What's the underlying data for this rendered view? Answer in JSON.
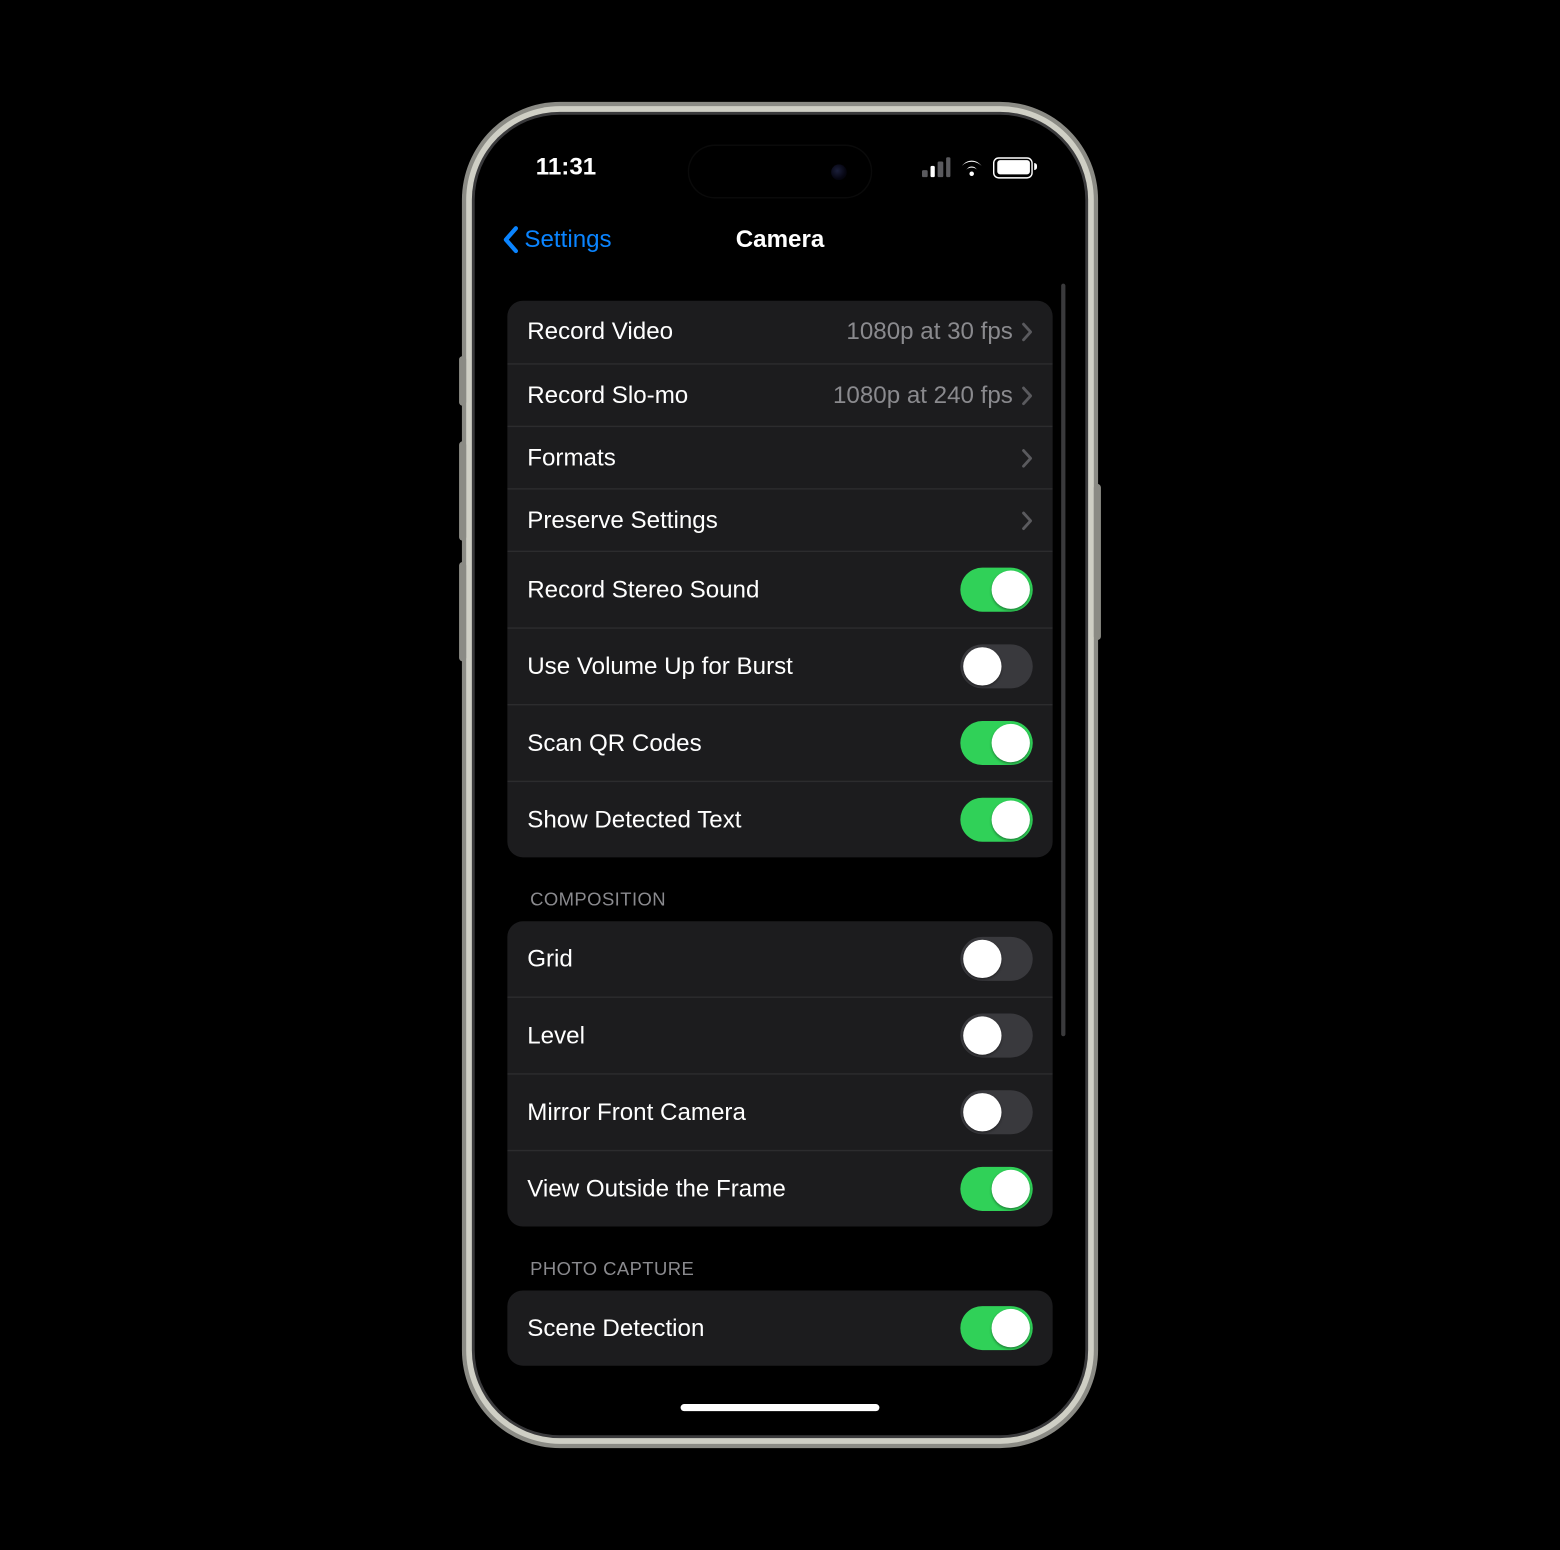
{
  "status": {
    "time": "11:31"
  },
  "nav": {
    "back_label": "Settings",
    "title": "Camera"
  },
  "group1": {
    "record_video": {
      "label": "Record Video",
      "value": "1080p at 30 fps"
    },
    "record_slomo": {
      "label": "Record Slo-mo",
      "value": "1080p at 240 fps"
    },
    "formats": {
      "label": "Formats"
    },
    "preserve": {
      "label": "Preserve Settings"
    },
    "stereo": {
      "label": "Record Stereo Sound",
      "on": true
    },
    "volburst": {
      "label": "Use Volume Up for Burst",
      "on": false
    },
    "qr": {
      "label": "Scan QR Codes",
      "on": true
    },
    "detected_text": {
      "label": "Show Detected Text",
      "on": true
    }
  },
  "composition": {
    "title": "COMPOSITION",
    "grid": {
      "label": "Grid",
      "on": false
    },
    "level": {
      "label": "Level",
      "on": false
    },
    "mirror": {
      "label": "Mirror Front Camera",
      "on": false
    },
    "outside": {
      "label": "View Outside the Frame",
      "on": true
    }
  },
  "photo_capture": {
    "title": "PHOTO CAPTURE",
    "scene": {
      "label": "Scene Detection",
      "on": true
    }
  }
}
